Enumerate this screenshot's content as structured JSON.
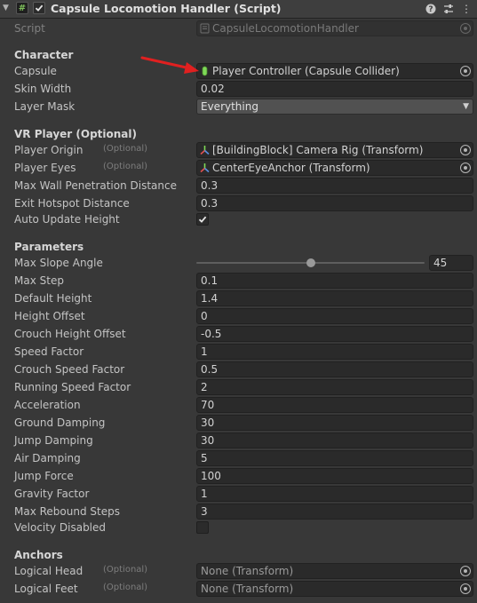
{
  "header": {
    "title": "Capsule Locomotion Handler (Script)",
    "enabled": true
  },
  "script_row": {
    "label": "Script",
    "value": "CapsuleLocomotionHandler"
  },
  "character": {
    "heading": "Character",
    "capsule": {
      "label": "Capsule",
      "value": "Player Controller (Capsule Collider)"
    },
    "skin_width": {
      "label": "Skin Width",
      "value": "0.02"
    },
    "layer_mask": {
      "label": "Layer Mask",
      "value": "Everything"
    }
  },
  "vr_player": {
    "heading": "VR Player (Optional)",
    "player_origin": {
      "label": "Player Origin",
      "tag": "(Optional)",
      "value": "[BuildingBlock] Camera Rig (Transform)"
    },
    "player_eyes": {
      "label": "Player Eyes",
      "tag": "(Optional)",
      "value": "CenterEyeAnchor (Transform)"
    },
    "max_wall_penetration": {
      "label": "Max Wall Penetration Distance",
      "value": "0.3"
    },
    "exit_hotspot": {
      "label": "Exit Hotspot Distance",
      "value": "0.3"
    },
    "auto_update_height": {
      "label": "Auto Update Height",
      "checked": true
    }
  },
  "parameters": {
    "heading": "Parameters",
    "max_slope_angle": {
      "label": "Max Slope Angle",
      "value": "45",
      "slider_fraction": 0.5
    },
    "rows": [
      {
        "label": "Max Step",
        "value": "0.1"
      },
      {
        "label": "Default Height",
        "value": "1.4"
      },
      {
        "label": "Height Offset",
        "value": "0"
      },
      {
        "label": "Crouch Height Offset",
        "value": "-0.5"
      },
      {
        "label": "Speed Factor",
        "value": "1"
      },
      {
        "label": "Crouch Speed Factor",
        "value": "0.5"
      },
      {
        "label": "Running Speed Factor",
        "value": "2"
      },
      {
        "label": "Acceleration",
        "value": "70"
      },
      {
        "label": "Ground Damping",
        "value": "30"
      },
      {
        "label": "Jump Damping",
        "value": "30"
      },
      {
        "label": "Air Damping",
        "value": "5"
      },
      {
        "label": "Jump Force",
        "value": "100"
      },
      {
        "label": "Gravity Factor",
        "value": "1"
      },
      {
        "label": "Max Rebound Steps",
        "value": "3"
      }
    ],
    "velocity_disabled": {
      "label": "Velocity Disabled",
      "checked": false
    }
  },
  "anchors": {
    "heading": "Anchors",
    "logical_head": {
      "label": "Logical Head",
      "tag": "(Optional)",
      "value": "None (Transform)"
    },
    "logical_feet": {
      "label": "Logical Feet",
      "tag": "(Optional)",
      "value": "None (Transform)"
    }
  },
  "colors": {
    "background": "#383838",
    "field": "#2a2a2a",
    "annotation_arrow": "#e02020",
    "capsule_icon": "#7ed957"
  }
}
